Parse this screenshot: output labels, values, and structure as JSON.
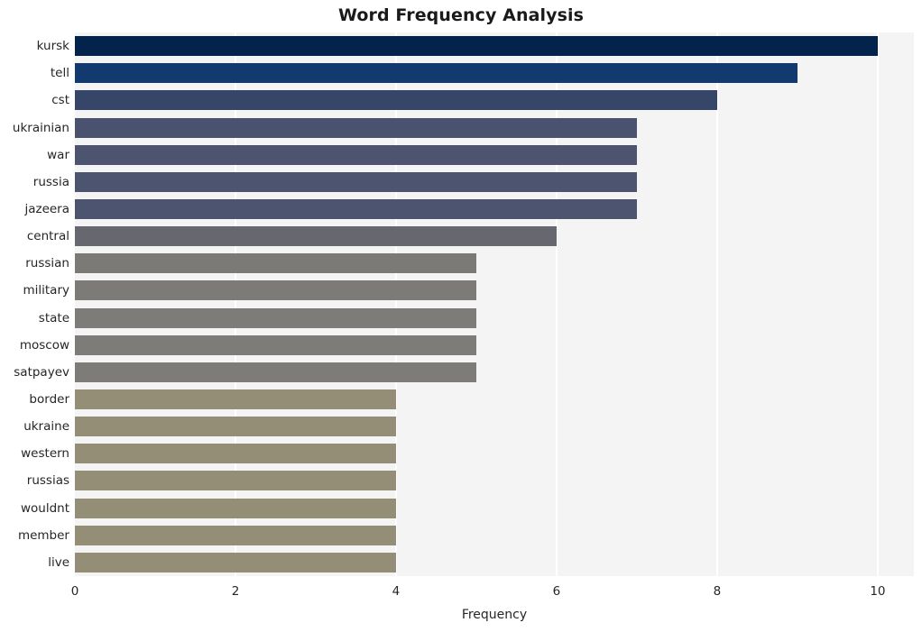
{
  "chart_data": {
    "type": "bar",
    "orientation": "horizontal",
    "title": "Word Frequency Analysis",
    "xlabel": "Frequency",
    "ylabel": "",
    "categories": [
      "kursk",
      "tell",
      "cst",
      "ukrainian",
      "war",
      "russia",
      "jazeera",
      "central",
      "russian",
      "military",
      "state",
      "moscow",
      "satpayev",
      "border",
      "ukraine",
      "western",
      "russias",
      "wouldnt",
      "member",
      "live"
    ],
    "values": [
      10,
      9,
      8,
      7,
      7,
      7,
      7,
      6,
      5,
      5,
      5,
      5,
      5,
      4,
      4,
      4,
      4,
      4,
      4,
      4
    ],
    "bar_colors": [
      "#04234c",
      "#123a6e",
      "#364668",
      "#4b5270",
      "#4d5470",
      "#4d5470",
      "#4d5470",
      "#66676f",
      "#7b7a77",
      "#7c7b78",
      "#7d7c78",
      "#7d7c78",
      "#7d7c78",
      "#948e76",
      "#948e76",
      "#948e76",
      "#948e76",
      "#948e76",
      "#948e76",
      "#948e76"
    ],
    "xlim": [
      0,
      10.45
    ],
    "xticks": [
      0,
      2,
      4,
      6,
      8,
      10
    ],
    "xtick_labels": [
      "0",
      "2",
      "4",
      "6",
      "8",
      "10"
    ],
    "grid": true,
    "grid_color": "#ffffff",
    "plot_background": "#f4f4f5",
    "figure_background": "#ffffff",
    "legend": null
  }
}
